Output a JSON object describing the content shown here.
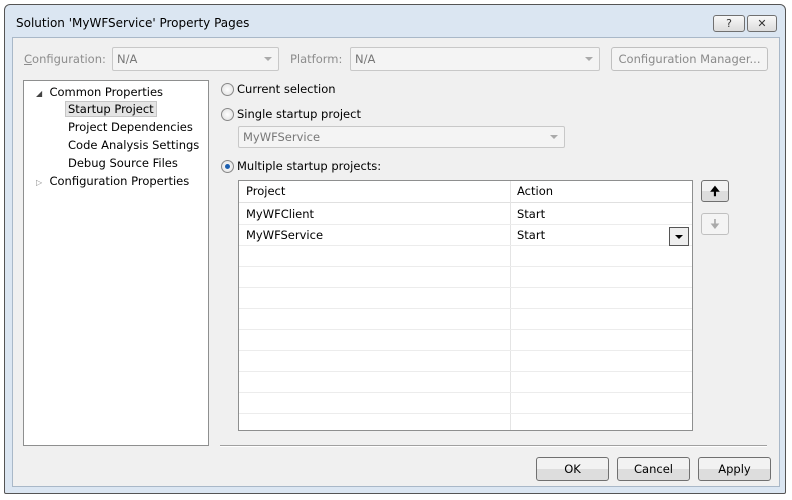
{
  "window": {
    "title": "Solution 'MyWFService' Property Pages",
    "help_icon": "?",
    "close_icon": "✕"
  },
  "toolbar": {
    "configuration_label": "Configuration:",
    "configuration_value": "N/A",
    "platform_label": "Platform:",
    "platform_value": "N/A",
    "config_manager_label": "Configuration Manager..."
  },
  "tree": {
    "items": [
      {
        "label": "Common Properties",
        "expanded": true
      },
      {
        "label": "Startup Project",
        "selected": true
      },
      {
        "label": "Project Dependencies"
      },
      {
        "label": "Code Analysis Settings"
      },
      {
        "label": "Debug Source Files"
      },
      {
        "label": "Configuration Properties",
        "expanded": false
      }
    ]
  },
  "options": {
    "current_selection": "Current selection",
    "single_startup": "Single startup project",
    "single_value": "MyWFService",
    "multiple_startup": "Multiple startup projects:",
    "selected": "multiple"
  },
  "grid": {
    "columns": [
      "Project",
      "Action"
    ],
    "rows": [
      {
        "project": "MyWFClient",
        "action": "Start"
      },
      {
        "project": "MyWFService",
        "action": "Start"
      }
    ]
  },
  "footer": {
    "ok": "OK",
    "cancel": "Cancel",
    "apply": "Apply"
  }
}
